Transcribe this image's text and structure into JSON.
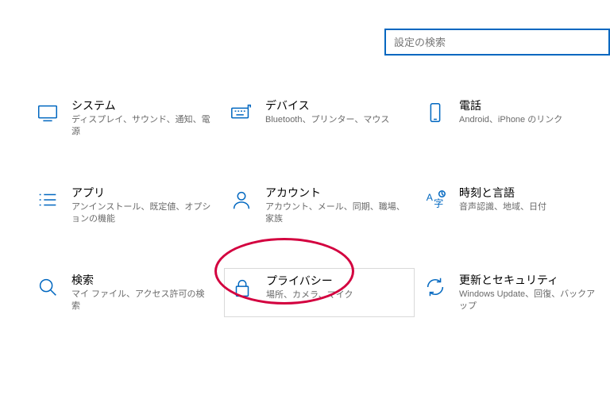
{
  "search": {
    "placeholder": "設定の検索"
  },
  "tiles": {
    "system": {
      "title": "システム",
      "desc": "ディスプレイ、サウンド、通知、電源"
    },
    "devices": {
      "title": "デバイス",
      "desc": "Bluetooth、プリンター、マウス"
    },
    "phone": {
      "title": "電話",
      "desc": "Android、iPhone のリンク"
    },
    "apps": {
      "title": "アプリ",
      "desc": "アンインストール、既定値、オプションの機能"
    },
    "accounts": {
      "title": "アカウント",
      "desc": "アカウント、メール、同期、職場、家族"
    },
    "time": {
      "title": "時刻と言語",
      "desc": "音声認識、地域、日付"
    },
    "search_t": {
      "title": "検索",
      "desc": "マイ ファイル、アクセス許可の検索"
    },
    "privacy": {
      "title": "プライバシー",
      "desc": "場所、カメラ、マイク"
    },
    "update": {
      "title": "更新とセキュリティ",
      "desc": "Windows Update、回復、バックアップ"
    }
  }
}
